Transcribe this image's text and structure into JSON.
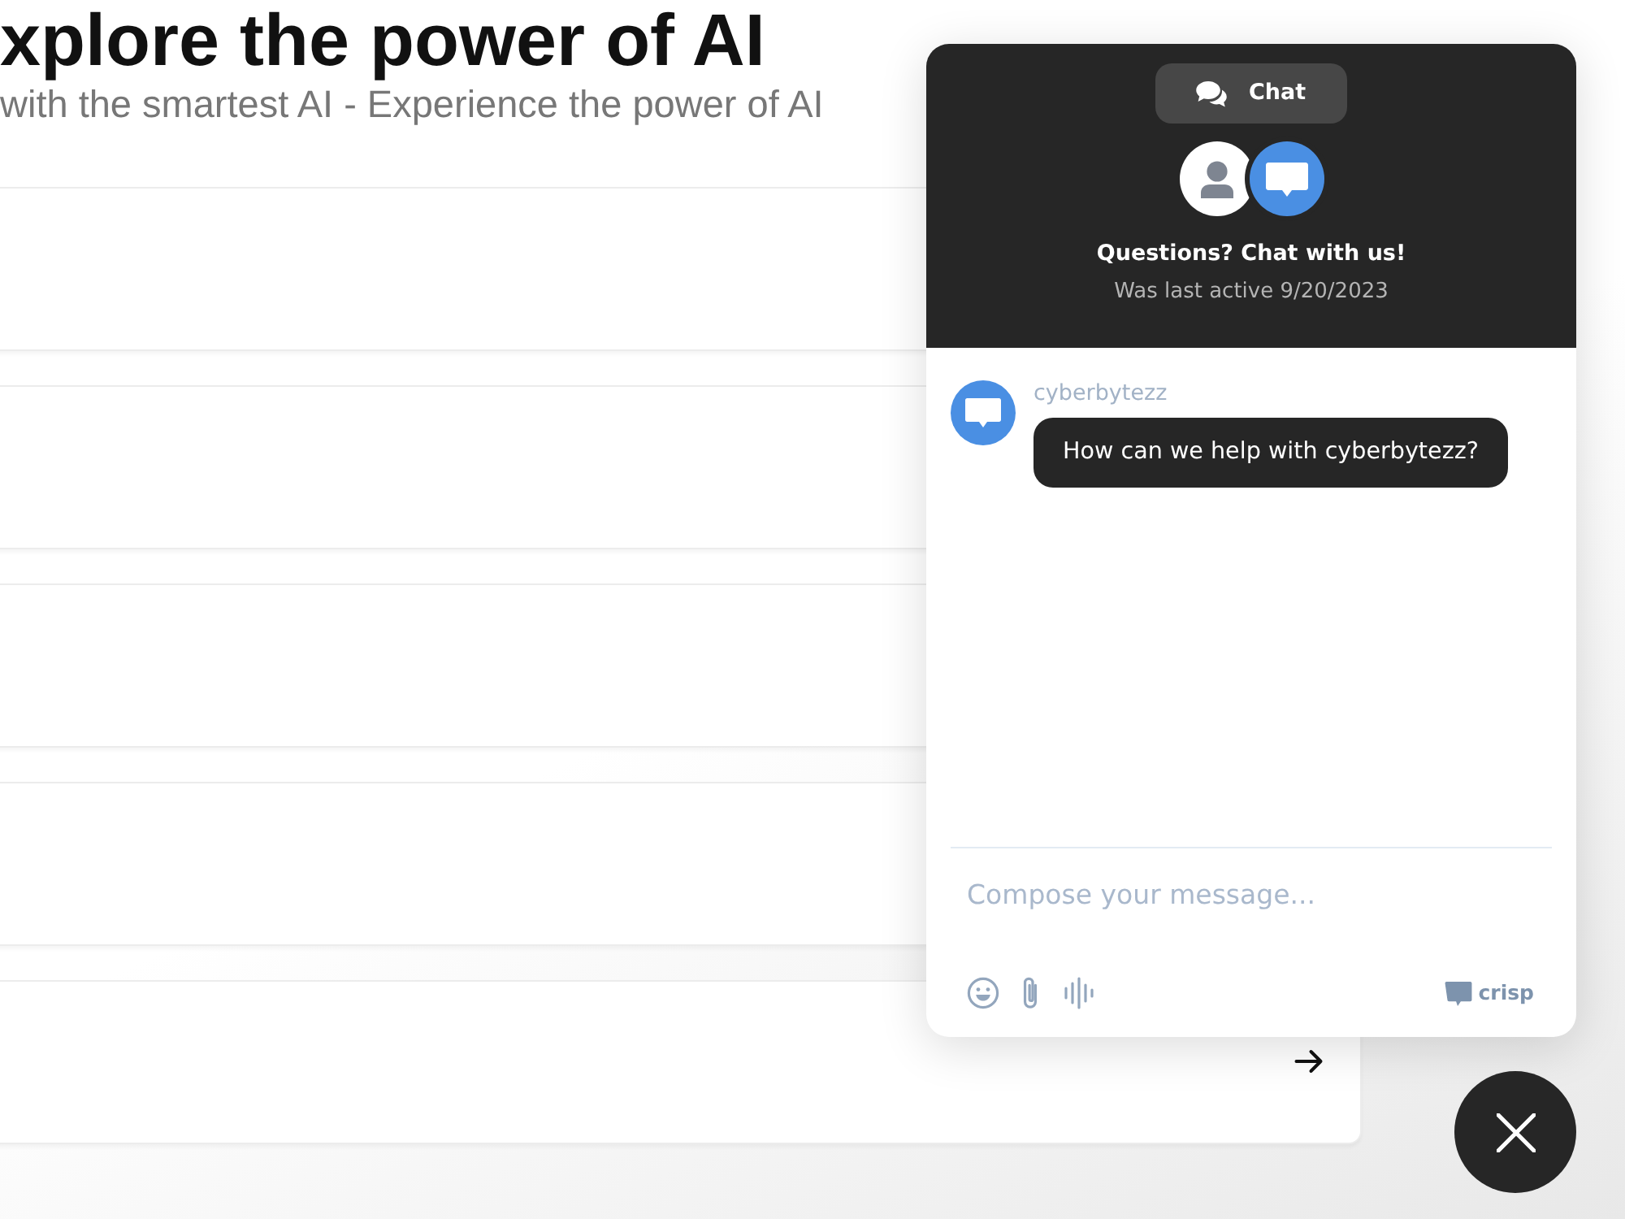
{
  "page": {
    "heading": "xplore the power of AI",
    "subtitle": "with the smartest AI - Experience the power of AI",
    "cards": [
      {
        "arrow": false
      },
      {
        "arrow": false
      },
      {
        "arrow": false
      },
      {
        "arrow": false
      },
      {
        "arrow": true
      }
    ]
  },
  "chat_widget": {
    "header": {
      "tab_label": "Chat",
      "title": "Questions? Chat with us!",
      "status": "Was last active 9/20/2023"
    },
    "messages": [
      {
        "sender": "cyberbytezz",
        "text": "How can we help with cyberbytezz?"
      }
    ],
    "compose": {
      "placeholder": "Compose your message..."
    },
    "brand": "crisp"
  }
}
